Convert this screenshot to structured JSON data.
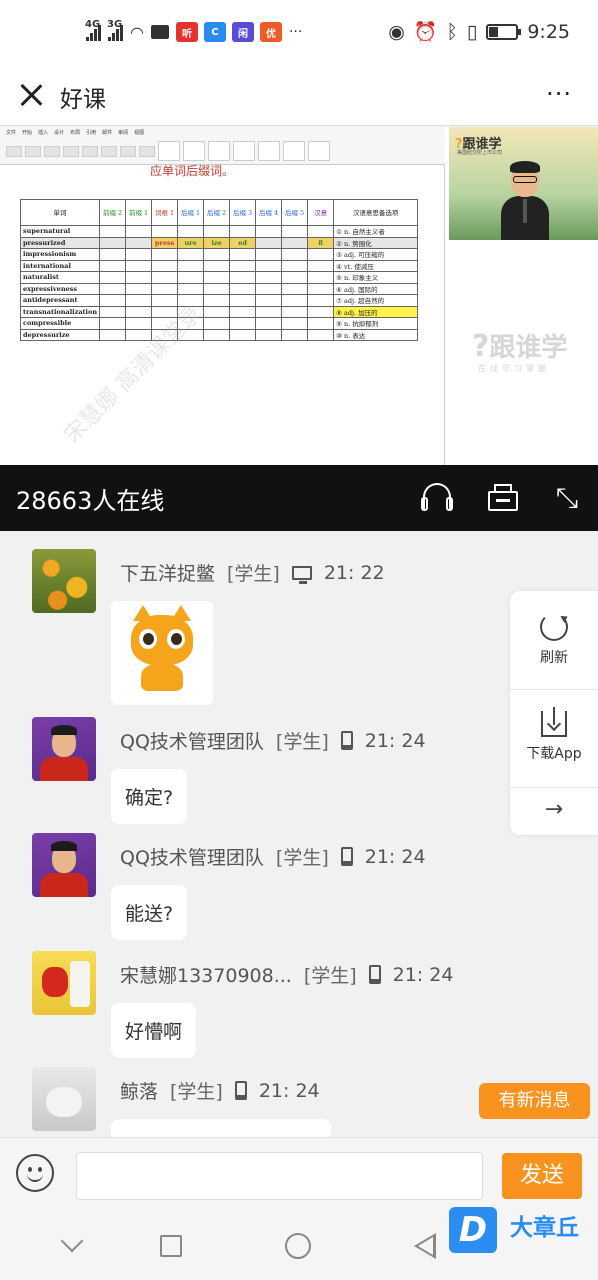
{
  "status_bar": {
    "net1": "4G",
    "net2": "3G",
    "apps": [
      {
        "name": "listen-app-icon",
        "text": "听",
        "color": "#e4332b"
      },
      {
        "name": "browser-app-icon",
        "text": "C",
        "color": "#2b8cf0"
      },
      {
        "name": "wallet-app-icon",
        "text": "闲",
        "color": "#5a4bd6"
      },
      {
        "name": "store-app-icon",
        "text": "优",
        "color": "#f05a28"
      }
    ],
    "more_dots": "···",
    "time": "9:25",
    "battery_level": 0.3
  },
  "titlebar": {
    "title": "好课",
    "more": "···"
  },
  "video": {
    "doc_title": "应单词后缀词。",
    "table_headers": [
      "单词",
      "前缀 2",
      "前缀 1",
      "词根 1",
      "后缀 1",
      "后缀 2",
      "后缀 3",
      "后缀 4",
      "后缀 5",
      "汉意",
      "汉语意思备选项"
    ],
    "rows": [
      {
        "word": "supernatural",
        "meaning": "① n. 自然主义者"
      },
      {
        "word": "pressurized",
        "meaning": "② n. 势围化",
        "root": "press",
        "s1": "ure",
        "s2": "ize",
        "s3": "ed",
        "hanyi": "8"
      },
      {
        "word": "impressionism",
        "meaning": "③ adj. 可压缩的"
      },
      {
        "word": "international",
        "meaning": "④ vt. 使减压"
      },
      {
        "word": "naturalist",
        "meaning": "⑤ n. 印象主义"
      },
      {
        "word": "expressiveness",
        "meaning": "⑥ adj. 国际的"
      },
      {
        "word": "antidepressant",
        "meaning": "⑦ adj. 超自然的"
      },
      {
        "word": "transnationalization",
        "meaning": "⑧ adj. 加压的"
      },
      {
        "word": "compressible",
        "meaning": "⑨ n. 抗抑郁剂"
      },
      {
        "word": "depressurize",
        "meaning": "⑩ n. 表达"
      }
    ],
    "teacher_logo": "跟谁学",
    "teacher_sub": "美国纽交所上市公司",
    "brand_watermark": "跟谁学",
    "brand_slogan": "在线学习掌握",
    "doc_watermark": "宋慧娜 高清课堂录"
  },
  "online_bar": {
    "online_text": "28663人在线"
  },
  "messages": [
    {
      "name": "下五洋捉鳖",
      "role": "[学生]",
      "device": "pc",
      "time": "21: 22",
      "content": "",
      "sticker": true
    },
    {
      "name": "QQ技术管理团队",
      "role": "[学生]",
      "device": "phone",
      "time": "21: 24",
      "content": "确定?"
    },
    {
      "name": "QQ技术管理团队",
      "role": "[学生]",
      "device": "phone",
      "time": "21: 24",
      "content": "能送?"
    },
    {
      "name": "宋慧娜13370908...",
      "role": "[学生]",
      "device": "phone",
      "time": "21: 24",
      "content": "好懵啊"
    },
    {
      "name": "鲸落",
      "role": "[学生]",
      "device": "phone",
      "time": "21: 24",
      "content": ""
    }
  ],
  "side_panel": {
    "refresh_label": "刷新",
    "download_label": "下载App",
    "arrow": "→"
  },
  "new_message_label": "有新消息",
  "input": {
    "placeholder": "",
    "send_label": "发送"
  },
  "watermark": {
    "logo": "D",
    "text": "大章丘"
  }
}
